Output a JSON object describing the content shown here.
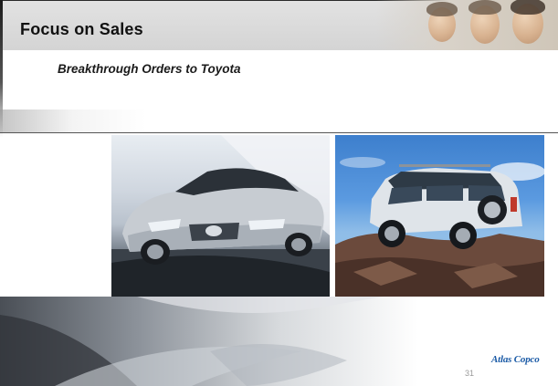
{
  "slide": {
    "title": "Focus on Sales",
    "subtitle": "Breakthrough Orders to Toyota",
    "page_number": "31",
    "logo_text": "Atlas Copco"
  },
  "images": [
    {
      "name": "lexus-sedan-photo",
      "subject": "silver Lexus GS sedan on a wet road"
    },
    {
      "name": "land-cruiser-photo",
      "subject": "silver Toyota Land Cruiser SUV on rocky hill under blue sky"
    }
  ],
  "colors": {
    "logo_blue": "#1a5aa6",
    "header_grey": "#d9d9d9",
    "divider": "#555555",
    "sky_blue": "#5b9ae0"
  }
}
